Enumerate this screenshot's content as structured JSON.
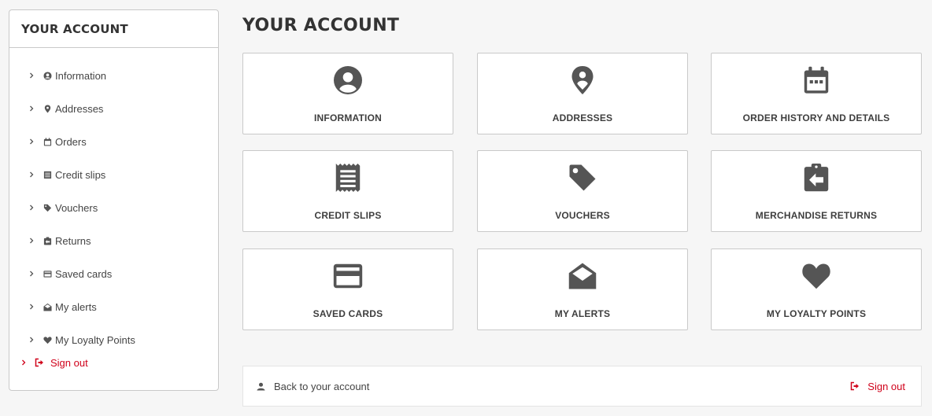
{
  "sidebar": {
    "title": "YOUR ACCOUNT",
    "items": [
      {
        "label": "Information",
        "icon": "user-circle-icon"
      },
      {
        "label": "Addresses",
        "icon": "map-pin-icon"
      },
      {
        "label": "Orders",
        "icon": "calendar-icon"
      },
      {
        "label": "Credit slips",
        "icon": "receipt-icon"
      },
      {
        "label": "Vouchers",
        "icon": "tag-icon"
      },
      {
        "label": "Returns",
        "icon": "return-clipboard-icon"
      },
      {
        "label": "Saved cards",
        "icon": "credit-card-icon"
      },
      {
        "label": "My alerts",
        "icon": "envelope-open-icon"
      },
      {
        "label": "My Loyalty Points",
        "icon": "heart-icon"
      }
    ],
    "signout_label": "Sign out"
  },
  "main": {
    "title": "YOUR ACCOUNT",
    "cards": [
      {
        "label": "INFORMATION",
        "icon": "user-circle-icon"
      },
      {
        "label": "ADDRESSES",
        "icon": "map-pin-icon"
      },
      {
        "label": "ORDER HISTORY AND DETAILS",
        "icon": "calendar-icon"
      },
      {
        "label": "CREDIT SLIPS",
        "icon": "receipt-icon"
      },
      {
        "label": "VOUCHERS",
        "icon": "tag-icon"
      },
      {
        "label": "MERCHANDISE RETURNS",
        "icon": "return-clipboard-icon"
      },
      {
        "label": "SAVED CARDS",
        "icon": "credit-card-icon"
      },
      {
        "label": "MY ALERTS",
        "icon": "envelope-open-icon"
      },
      {
        "label": "MY LOYALTY POINTS",
        "icon": "heart-icon"
      }
    ]
  },
  "footer": {
    "back_label": "Back to your account",
    "signout_label": "Sign out"
  },
  "colors": {
    "accent_red": "#d0021b",
    "icon_gray": "#555555",
    "border": "#c9c9c9",
    "background": "#f6f6f6"
  }
}
